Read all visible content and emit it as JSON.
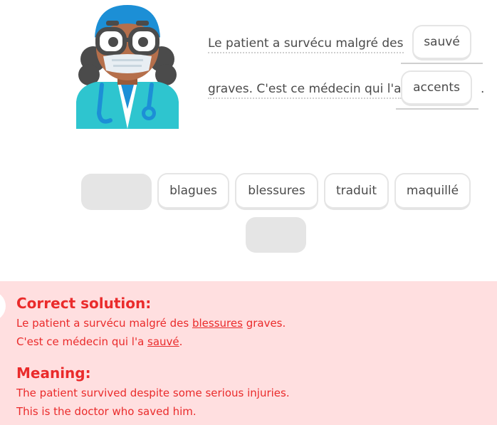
{
  "prompt": {
    "line1": "Le patient a survécu malgré des",
    "line2": "graves. C'est ce médecin qui l'a",
    "line2_end": ".",
    "blank1_answer": "sauvé",
    "blank2_answer": "accents"
  },
  "word_bank": [
    "blagues",
    "blessures",
    "traduit",
    "maquillé"
  ],
  "feedback": {
    "solution_heading": "Correct solution:",
    "solution_line1_before": "Le patient a survécu malgré des ",
    "solution_line1_highlight": "blessures",
    "solution_line1_after": " graves.",
    "solution_line2_before": "C'est ce médecin qui l'a ",
    "solution_line2_highlight": "sauvé",
    "solution_line2_after": ".",
    "meaning_heading": "Meaning:",
    "meaning_line1": "The patient survived despite some serious injuries.",
    "meaning_line2": "This is the doctor who saved him."
  },
  "colors": {
    "error_bg": "#ffdfe0",
    "error_text": "#ea2b2b",
    "text": "#4b4b4b",
    "chip_border": "#e5e5e5"
  },
  "icons": [
    "doctor-character-icon"
  ]
}
